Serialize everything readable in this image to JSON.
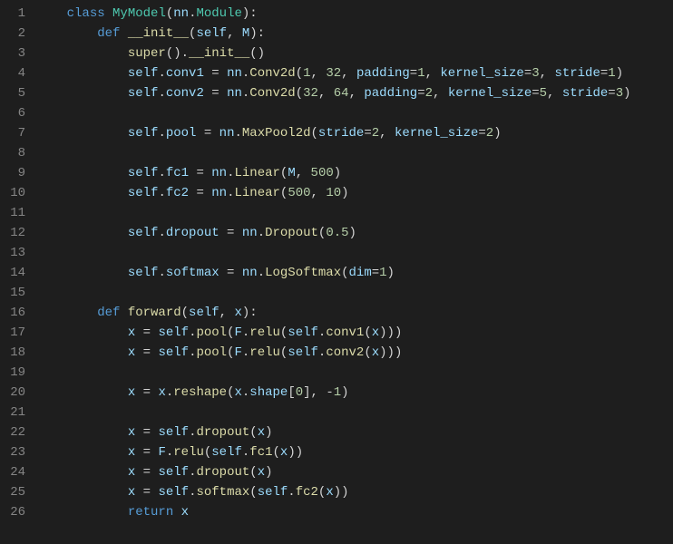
{
  "lines": [
    {
      "n": 1,
      "tokens": [
        {
          "t": "    ",
          "c": "pun"
        },
        {
          "t": "class ",
          "c": "kw"
        },
        {
          "t": "MyModel",
          "c": "cls"
        },
        {
          "t": "(",
          "c": "pun"
        },
        {
          "t": "nn",
          "c": "var"
        },
        {
          "t": ".",
          "c": "pun"
        },
        {
          "t": "Module",
          "c": "cls"
        },
        {
          "t": "):",
          "c": "pun"
        }
      ]
    },
    {
      "n": 2,
      "tokens": [
        {
          "t": "        ",
          "c": "pun"
        },
        {
          "t": "def ",
          "c": "kw"
        },
        {
          "t": "__init__",
          "c": "dunder"
        },
        {
          "t": "(",
          "c": "pun"
        },
        {
          "t": "self",
          "c": "self"
        },
        {
          "t": ", ",
          "c": "pun"
        },
        {
          "t": "M",
          "c": "parm"
        },
        {
          "t": "):",
          "c": "pun"
        }
      ]
    },
    {
      "n": 3,
      "tokens": [
        {
          "t": "            ",
          "c": "pun"
        },
        {
          "t": "super",
          "c": "fn"
        },
        {
          "t": "().",
          "c": "pun"
        },
        {
          "t": "__init__",
          "c": "dunder"
        },
        {
          "t": "()",
          "c": "pun"
        }
      ]
    },
    {
      "n": 4,
      "tokens": [
        {
          "t": "            ",
          "c": "pun"
        },
        {
          "t": "self",
          "c": "self"
        },
        {
          "t": ".",
          "c": "pun"
        },
        {
          "t": "conv1",
          "c": "var"
        },
        {
          "t": " = ",
          "c": "op"
        },
        {
          "t": "nn",
          "c": "var"
        },
        {
          "t": ".",
          "c": "pun"
        },
        {
          "t": "Conv2d",
          "c": "fn"
        },
        {
          "t": "(",
          "c": "pun"
        },
        {
          "t": "1",
          "c": "num"
        },
        {
          "t": ", ",
          "c": "pun"
        },
        {
          "t": "32",
          "c": "num"
        },
        {
          "t": ", ",
          "c": "pun"
        },
        {
          "t": "padding",
          "c": "parm"
        },
        {
          "t": "=",
          "c": "op"
        },
        {
          "t": "1",
          "c": "num"
        },
        {
          "t": ", ",
          "c": "pun"
        },
        {
          "t": "kernel_size",
          "c": "parm"
        },
        {
          "t": "=",
          "c": "op"
        },
        {
          "t": "3",
          "c": "num"
        },
        {
          "t": ", ",
          "c": "pun"
        },
        {
          "t": "stride",
          "c": "parm"
        },
        {
          "t": "=",
          "c": "op"
        },
        {
          "t": "1",
          "c": "num"
        },
        {
          "t": ")",
          "c": "pun"
        }
      ]
    },
    {
      "n": 5,
      "tokens": [
        {
          "t": "            ",
          "c": "pun"
        },
        {
          "t": "self",
          "c": "self"
        },
        {
          "t": ".",
          "c": "pun"
        },
        {
          "t": "conv2",
          "c": "var"
        },
        {
          "t": " = ",
          "c": "op"
        },
        {
          "t": "nn",
          "c": "var"
        },
        {
          "t": ".",
          "c": "pun"
        },
        {
          "t": "Conv2d",
          "c": "fn"
        },
        {
          "t": "(",
          "c": "pun"
        },
        {
          "t": "32",
          "c": "num"
        },
        {
          "t": ", ",
          "c": "pun"
        },
        {
          "t": "64",
          "c": "num"
        },
        {
          "t": ", ",
          "c": "pun"
        },
        {
          "t": "padding",
          "c": "parm"
        },
        {
          "t": "=",
          "c": "op"
        },
        {
          "t": "2",
          "c": "num"
        },
        {
          "t": ", ",
          "c": "pun"
        },
        {
          "t": "kernel_size",
          "c": "parm"
        },
        {
          "t": "=",
          "c": "op"
        },
        {
          "t": "5",
          "c": "num"
        },
        {
          "t": ", ",
          "c": "pun"
        },
        {
          "t": "stride",
          "c": "parm"
        },
        {
          "t": "=",
          "c": "op"
        },
        {
          "t": "3",
          "c": "num"
        },
        {
          "t": ")",
          "c": "pun"
        }
      ]
    },
    {
      "n": 6,
      "tokens": [
        {
          "t": "",
          "c": "pun"
        }
      ]
    },
    {
      "n": 7,
      "tokens": [
        {
          "t": "            ",
          "c": "pun"
        },
        {
          "t": "self",
          "c": "self"
        },
        {
          "t": ".",
          "c": "pun"
        },
        {
          "t": "pool",
          "c": "var"
        },
        {
          "t": " = ",
          "c": "op"
        },
        {
          "t": "nn",
          "c": "var"
        },
        {
          "t": ".",
          "c": "pun"
        },
        {
          "t": "MaxPool2d",
          "c": "fn"
        },
        {
          "t": "(",
          "c": "pun"
        },
        {
          "t": "stride",
          "c": "parm"
        },
        {
          "t": "=",
          "c": "op"
        },
        {
          "t": "2",
          "c": "num"
        },
        {
          "t": ", ",
          "c": "pun"
        },
        {
          "t": "kernel_size",
          "c": "parm"
        },
        {
          "t": "=",
          "c": "op"
        },
        {
          "t": "2",
          "c": "num"
        },
        {
          "t": ")",
          "c": "pun"
        }
      ]
    },
    {
      "n": 8,
      "tokens": [
        {
          "t": "",
          "c": "pun"
        }
      ]
    },
    {
      "n": 9,
      "tokens": [
        {
          "t": "            ",
          "c": "pun"
        },
        {
          "t": "self",
          "c": "self"
        },
        {
          "t": ".",
          "c": "pun"
        },
        {
          "t": "fc1",
          "c": "var"
        },
        {
          "t": " = ",
          "c": "op"
        },
        {
          "t": "nn",
          "c": "var"
        },
        {
          "t": ".",
          "c": "pun"
        },
        {
          "t": "Linear",
          "c": "fn"
        },
        {
          "t": "(",
          "c": "pun"
        },
        {
          "t": "M",
          "c": "var"
        },
        {
          "t": ", ",
          "c": "pun"
        },
        {
          "t": "500",
          "c": "num"
        },
        {
          "t": ")",
          "c": "pun"
        }
      ]
    },
    {
      "n": 10,
      "tokens": [
        {
          "t": "            ",
          "c": "pun"
        },
        {
          "t": "self",
          "c": "self"
        },
        {
          "t": ".",
          "c": "pun"
        },
        {
          "t": "fc2",
          "c": "var"
        },
        {
          "t": " = ",
          "c": "op"
        },
        {
          "t": "nn",
          "c": "var"
        },
        {
          "t": ".",
          "c": "pun"
        },
        {
          "t": "Linear",
          "c": "fn"
        },
        {
          "t": "(",
          "c": "pun"
        },
        {
          "t": "500",
          "c": "num"
        },
        {
          "t": ", ",
          "c": "pun"
        },
        {
          "t": "10",
          "c": "num"
        },
        {
          "t": ")",
          "c": "pun"
        }
      ]
    },
    {
      "n": 11,
      "tokens": [
        {
          "t": "",
          "c": "pun"
        }
      ]
    },
    {
      "n": 12,
      "tokens": [
        {
          "t": "            ",
          "c": "pun"
        },
        {
          "t": "self",
          "c": "self"
        },
        {
          "t": ".",
          "c": "pun"
        },
        {
          "t": "dropout",
          "c": "var"
        },
        {
          "t": " = ",
          "c": "op"
        },
        {
          "t": "nn",
          "c": "var"
        },
        {
          "t": ".",
          "c": "pun"
        },
        {
          "t": "Dropout",
          "c": "fn"
        },
        {
          "t": "(",
          "c": "pun"
        },
        {
          "t": "0.5",
          "c": "num"
        },
        {
          "t": ")",
          "c": "pun"
        }
      ]
    },
    {
      "n": 13,
      "tokens": [
        {
          "t": "",
          "c": "pun"
        }
      ]
    },
    {
      "n": 14,
      "tokens": [
        {
          "t": "            ",
          "c": "pun"
        },
        {
          "t": "self",
          "c": "self"
        },
        {
          "t": ".",
          "c": "pun"
        },
        {
          "t": "softmax",
          "c": "var"
        },
        {
          "t": " = ",
          "c": "op"
        },
        {
          "t": "nn",
          "c": "var"
        },
        {
          "t": ".",
          "c": "pun"
        },
        {
          "t": "LogSoftmax",
          "c": "fn"
        },
        {
          "t": "(",
          "c": "pun"
        },
        {
          "t": "dim",
          "c": "parm"
        },
        {
          "t": "=",
          "c": "op"
        },
        {
          "t": "1",
          "c": "num"
        },
        {
          "t": ")",
          "c": "pun"
        }
      ]
    },
    {
      "n": 15,
      "tokens": [
        {
          "t": "",
          "c": "pun"
        }
      ]
    },
    {
      "n": 16,
      "tokens": [
        {
          "t": "        ",
          "c": "pun"
        },
        {
          "t": "def ",
          "c": "kw"
        },
        {
          "t": "forward",
          "c": "fn"
        },
        {
          "t": "(",
          "c": "pun"
        },
        {
          "t": "self",
          "c": "self"
        },
        {
          "t": ", ",
          "c": "pun"
        },
        {
          "t": "x",
          "c": "parm"
        },
        {
          "t": "):",
          "c": "pun"
        }
      ]
    },
    {
      "n": 17,
      "tokens": [
        {
          "t": "            ",
          "c": "pun"
        },
        {
          "t": "x",
          "c": "var"
        },
        {
          "t": " = ",
          "c": "op"
        },
        {
          "t": "self",
          "c": "self"
        },
        {
          "t": ".",
          "c": "pun"
        },
        {
          "t": "pool",
          "c": "fn"
        },
        {
          "t": "(",
          "c": "pun"
        },
        {
          "t": "F",
          "c": "var"
        },
        {
          "t": ".",
          "c": "pun"
        },
        {
          "t": "relu",
          "c": "fn"
        },
        {
          "t": "(",
          "c": "pun"
        },
        {
          "t": "self",
          "c": "self"
        },
        {
          "t": ".",
          "c": "pun"
        },
        {
          "t": "conv1",
          "c": "fn"
        },
        {
          "t": "(",
          "c": "pun"
        },
        {
          "t": "x",
          "c": "var"
        },
        {
          "t": ")))",
          "c": "pun"
        }
      ]
    },
    {
      "n": 18,
      "tokens": [
        {
          "t": "            ",
          "c": "pun"
        },
        {
          "t": "x",
          "c": "var"
        },
        {
          "t": " = ",
          "c": "op"
        },
        {
          "t": "self",
          "c": "self"
        },
        {
          "t": ".",
          "c": "pun"
        },
        {
          "t": "pool",
          "c": "fn"
        },
        {
          "t": "(",
          "c": "pun"
        },
        {
          "t": "F",
          "c": "var"
        },
        {
          "t": ".",
          "c": "pun"
        },
        {
          "t": "relu",
          "c": "fn"
        },
        {
          "t": "(",
          "c": "pun"
        },
        {
          "t": "self",
          "c": "self"
        },
        {
          "t": ".",
          "c": "pun"
        },
        {
          "t": "conv2",
          "c": "fn"
        },
        {
          "t": "(",
          "c": "pun"
        },
        {
          "t": "x",
          "c": "var"
        },
        {
          "t": ")))",
          "c": "pun"
        }
      ]
    },
    {
      "n": 19,
      "tokens": [
        {
          "t": "",
          "c": "pun"
        }
      ]
    },
    {
      "n": 20,
      "tokens": [
        {
          "t": "            ",
          "c": "pun"
        },
        {
          "t": "x",
          "c": "var"
        },
        {
          "t": " = ",
          "c": "op"
        },
        {
          "t": "x",
          "c": "var"
        },
        {
          "t": ".",
          "c": "pun"
        },
        {
          "t": "reshape",
          "c": "fn"
        },
        {
          "t": "(",
          "c": "pun"
        },
        {
          "t": "x",
          "c": "var"
        },
        {
          "t": ".",
          "c": "pun"
        },
        {
          "t": "shape",
          "c": "var"
        },
        {
          "t": "[",
          "c": "pun"
        },
        {
          "t": "0",
          "c": "num"
        },
        {
          "t": "], ",
          "c": "pun"
        },
        {
          "t": "-",
          "c": "op"
        },
        {
          "t": "1",
          "c": "num"
        },
        {
          "t": ")",
          "c": "pun"
        }
      ]
    },
    {
      "n": 21,
      "tokens": [
        {
          "t": "",
          "c": "pun"
        }
      ]
    },
    {
      "n": 22,
      "tokens": [
        {
          "t": "            ",
          "c": "pun"
        },
        {
          "t": "x",
          "c": "var"
        },
        {
          "t": " = ",
          "c": "op"
        },
        {
          "t": "self",
          "c": "self"
        },
        {
          "t": ".",
          "c": "pun"
        },
        {
          "t": "dropout",
          "c": "fn"
        },
        {
          "t": "(",
          "c": "pun"
        },
        {
          "t": "x",
          "c": "var"
        },
        {
          "t": ")",
          "c": "pun"
        }
      ]
    },
    {
      "n": 23,
      "tokens": [
        {
          "t": "            ",
          "c": "pun"
        },
        {
          "t": "x",
          "c": "var"
        },
        {
          "t": " = ",
          "c": "op"
        },
        {
          "t": "F",
          "c": "var"
        },
        {
          "t": ".",
          "c": "pun"
        },
        {
          "t": "relu",
          "c": "fn"
        },
        {
          "t": "(",
          "c": "pun"
        },
        {
          "t": "self",
          "c": "self"
        },
        {
          "t": ".",
          "c": "pun"
        },
        {
          "t": "fc1",
          "c": "fn"
        },
        {
          "t": "(",
          "c": "pun"
        },
        {
          "t": "x",
          "c": "var"
        },
        {
          "t": "))",
          "c": "pun"
        }
      ]
    },
    {
      "n": 24,
      "tokens": [
        {
          "t": "            ",
          "c": "pun"
        },
        {
          "t": "x",
          "c": "var"
        },
        {
          "t": " = ",
          "c": "op"
        },
        {
          "t": "self",
          "c": "self"
        },
        {
          "t": ".",
          "c": "pun"
        },
        {
          "t": "dropout",
          "c": "fn"
        },
        {
          "t": "(",
          "c": "pun"
        },
        {
          "t": "x",
          "c": "var"
        },
        {
          "t": ")",
          "c": "pun"
        }
      ]
    },
    {
      "n": 25,
      "tokens": [
        {
          "t": "            ",
          "c": "pun"
        },
        {
          "t": "x",
          "c": "var"
        },
        {
          "t": " = ",
          "c": "op"
        },
        {
          "t": "self",
          "c": "self"
        },
        {
          "t": ".",
          "c": "pun"
        },
        {
          "t": "softmax",
          "c": "fn"
        },
        {
          "t": "(",
          "c": "pun"
        },
        {
          "t": "self",
          "c": "self"
        },
        {
          "t": ".",
          "c": "pun"
        },
        {
          "t": "fc2",
          "c": "fn"
        },
        {
          "t": "(",
          "c": "pun"
        },
        {
          "t": "x",
          "c": "var"
        },
        {
          "t": "))",
          "c": "pun"
        }
      ]
    },
    {
      "n": 26,
      "tokens": [
        {
          "t": "            ",
          "c": "pun"
        },
        {
          "t": "return ",
          "c": "kw"
        },
        {
          "t": "x",
          "c": "var"
        }
      ]
    }
  ]
}
